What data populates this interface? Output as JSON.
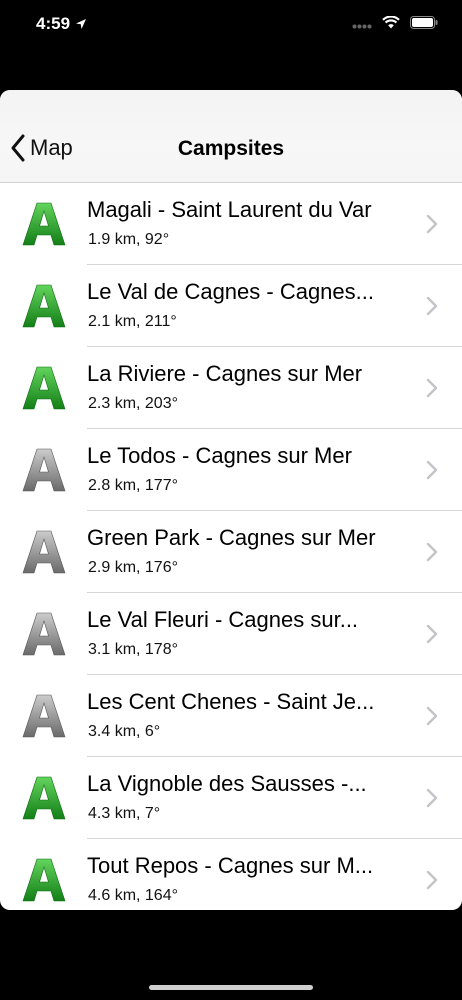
{
  "status_bar": {
    "time": "4:59"
  },
  "nav": {
    "back_label": "Map",
    "title": "Campsites"
  },
  "colors": {
    "green_top": "#5fd05a",
    "green_bottom": "#168a1a",
    "gray_top": "#c8c8c8",
    "gray_bottom": "#6e6e6e",
    "chevron": "#c4c4c8"
  },
  "rows": [
    {
      "title": "Magali - Saint Laurent du Var",
      "subtitle": "1.9 km, 92°",
      "icon": "green-a-icon"
    },
    {
      "title": "Le Val de Cagnes - Cagnes...",
      "subtitle": "2.1 km, 211°",
      "icon": "green-a-icon"
    },
    {
      "title": "La Riviere - Cagnes sur Mer",
      "subtitle": "2.3 km, 203°",
      "icon": "green-a-icon"
    },
    {
      "title": "Le Todos - Cagnes sur Mer",
      "subtitle": "2.8 km, 177°",
      "icon": "gray-a-icon"
    },
    {
      "title": "Green Park - Cagnes sur Mer",
      "subtitle": "2.9 km, 176°",
      "icon": "gray-a-icon"
    },
    {
      "title": "Le Val Fleuri - Cagnes sur...",
      "subtitle": "3.1 km, 178°",
      "icon": "gray-a-icon"
    },
    {
      "title": "Les Cent Chenes - Saint Je...",
      "subtitle": "3.4 km, 6°",
      "icon": "gray-a-icon"
    },
    {
      "title": "La Vignoble des Sausses -...",
      "subtitle": "4.3 km, 7°",
      "icon": "green-a-icon"
    },
    {
      "title": "Tout Repos - Cagnes sur M...",
      "subtitle": "4.6 km, 164°",
      "icon": "green-a-icon"
    }
  ]
}
